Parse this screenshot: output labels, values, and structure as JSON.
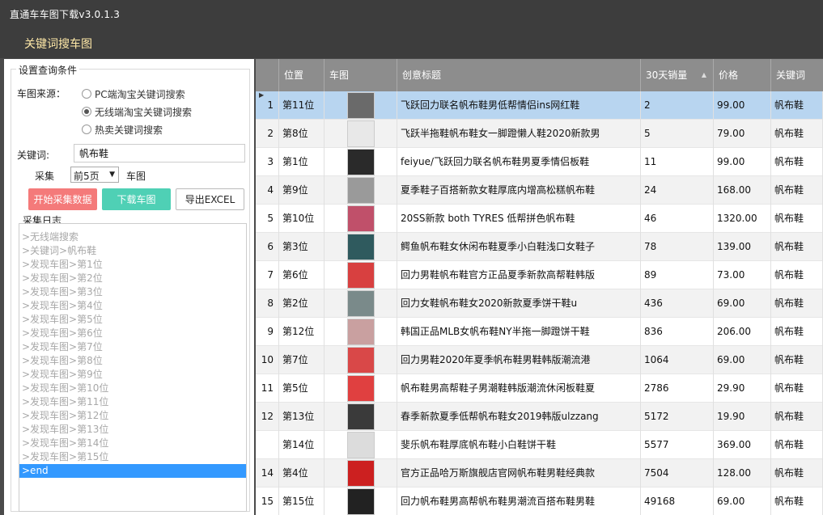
{
  "window": {
    "title": "直通车车图下载v3.0.1.3"
  },
  "section_title": "关键词搜车图",
  "conditions": {
    "legend": "设置查询条件",
    "source_label": "车图来源：",
    "sources": [
      {
        "label": "PC端淘宝关键词搜索",
        "selected": false
      },
      {
        "label": "无线端淘宝关键词搜索",
        "selected": true
      },
      {
        "label": "热卖关键词搜索",
        "selected": false
      }
    ],
    "keyword_label": "关键词:",
    "keyword_value": "帆布鞋",
    "collect_label": "采集",
    "pages_value": "前5页",
    "collect_suffix": "车图",
    "buttons": {
      "start": "开始采集数据",
      "download": "下载车图",
      "export": "导出EXCEL"
    }
  },
  "log": {
    "legend": "采集日志",
    "lines": [
      ">无线端搜索",
      ">关键词>帆布鞋",
      ">发现车图>第1位",
      ">发现车图>第2位",
      ">发现车图>第3位",
      ">发现车图>第4位",
      ">发现车图>第5位",
      ">发现车图>第6位",
      ">发现车图>第7位",
      ">发现车图>第8位",
      ">发现车图>第9位",
      ">发现车图>第10位",
      ">发现车图>第11位",
      ">发现车图>第12位",
      ">发现车图>第13位",
      ">发现车图>第14位",
      ">发现车图>第15位",
      ">end"
    ]
  },
  "table": {
    "columns": [
      "位置",
      "车图",
      "创意标题",
      "30天销量",
      "价格",
      "关键词"
    ],
    "sort_icon": "sort-up-icon",
    "rows": [
      {
        "idx": "1",
        "pos": "第11位",
        "title": "飞跃回力联名帆布鞋男低帮情侣ins网红鞋",
        "sales": "2",
        "price": "99.00",
        "kw": "帆布鞋",
        "thumb": "#6a6a6a"
      },
      {
        "idx": "2",
        "pos": "第8位",
        "title": "飞跃半拖鞋帆布鞋女一脚蹬懒人鞋2020新款男",
        "sales": "5",
        "price": "79.00",
        "kw": "帆布鞋",
        "thumb": "#e8e8e8"
      },
      {
        "idx": "3",
        "pos": "第1位",
        "title": "feiyue/飞跃回力联名帆布鞋男夏季情侣板鞋",
        "sales": "11",
        "price": "99.00",
        "kw": "帆布鞋",
        "thumb": "#2a2a2a"
      },
      {
        "idx": "4",
        "pos": "第9位",
        "title": "夏季鞋子百搭新款女鞋厚底内增高松糕帆布鞋",
        "sales": "24",
        "price": "168.00",
        "kw": "帆布鞋",
        "thumb": "#9a9a9a"
      },
      {
        "idx": "5",
        "pos": "第10位",
        "title": "20SS新款 both TYRES 低帮拼色帆布鞋",
        "sales": "46",
        "price": "1320.00",
        "kw": "帆布鞋",
        "thumb": "#c0506a"
      },
      {
        "idx": "6",
        "pos": "第3位",
        "title": "鳄鱼帆布鞋女休闲布鞋夏季小白鞋浅口女鞋子",
        "sales": "78",
        "price": "139.00",
        "kw": "帆布鞋",
        "thumb": "#2f5a5e"
      },
      {
        "idx": "7",
        "pos": "第6位",
        "title": "回力男鞋帆布鞋官方正品夏季新款高帮鞋韩版",
        "sales": "89",
        "price": "73.00",
        "kw": "帆布鞋",
        "thumb": "#d84040"
      },
      {
        "idx": "8",
        "pos": "第2位",
        "title": "回力女鞋帆布鞋女2020新款夏季饼干鞋u",
        "sales": "436",
        "price": "69.00",
        "kw": "帆布鞋",
        "thumb": "#7a8a8a"
      },
      {
        "idx": "9",
        "pos": "第12位",
        "title": "韩国正品MLB女帆布鞋NY半拖一脚蹬饼干鞋",
        "sales": "836",
        "price": "206.00",
        "kw": "帆布鞋",
        "thumb": "#c9a0a0"
      },
      {
        "idx": "10",
        "pos": "第7位",
        "title": "回力男鞋2020年夏季帆布鞋男鞋韩版潮流港",
        "sales": "1064",
        "price": "69.00",
        "kw": "帆布鞋",
        "thumb": "#d94848"
      },
      {
        "idx": "11",
        "pos": "第5位",
        "title": "帆布鞋男高帮鞋子男潮鞋韩版潮流休闲板鞋夏",
        "sales": "2786",
        "price": "29.90",
        "kw": "帆布鞋",
        "thumb": "#e04040"
      },
      {
        "idx": "12",
        "pos": "第13位",
        "title": "春季新款夏季低帮帆布鞋女2019韩版ulzzang",
        "sales": "5172",
        "price": "19.90",
        "kw": "帆布鞋",
        "thumb": "#3a3a3a"
      },
      {
        "idx": "",
        "pos": "第14位",
        "title": "斐乐帆布鞋厚底帆布鞋小白鞋饼干鞋",
        "sales": "5577",
        "price": "369.00",
        "kw": "帆布鞋",
        "thumb": "#dcdcdc"
      },
      {
        "idx": "14",
        "pos": "第4位",
        "title": "官方正品哈万斯旗舰店官网帆布鞋男鞋经典款",
        "sales": "7504",
        "price": "128.00",
        "kw": "帆布鞋",
        "thumb": "#cc2020"
      },
      {
        "idx": "15",
        "pos": "第15位",
        "title": "回力帆布鞋男高帮帆布鞋男潮流百搭布鞋男鞋",
        "sales": "49168",
        "price": "69.00",
        "kw": "帆布鞋",
        "thumb": "#222222"
      }
    ]
  }
}
